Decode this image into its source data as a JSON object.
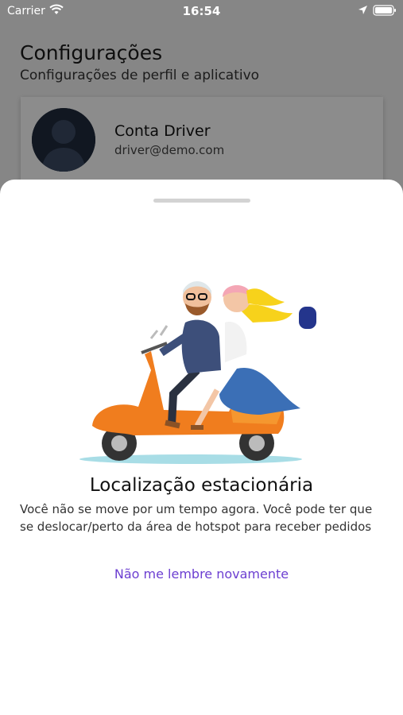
{
  "status_bar": {
    "carrier": "Carrier",
    "time": "16:54",
    "icons": [
      "wifi-icon",
      "location-arrow-icon",
      "battery-icon"
    ]
  },
  "settings": {
    "title": "Configurações",
    "subtitle": "Configurações de perfil e aplicativo",
    "profile": {
      "name": "Conta Driver",
      "email": "driver@demo.com"
    }
  },
  "sheet": {
    "title": "Localização estacionária",
    "message": "Você não se move por um tempo agora. Você pode ter que se deslocar/perto da área de hotspot para receber pedidos",
    "dismiss_label": "Não me lembre novamente",
    "illustration": "couple-on-scooter-illustration"
  },
  "colors": {
    "link": "#6c3fd1",
    "scooter": "#f07d1e",
    "sheet_background": "#ffffff"
  }
}
